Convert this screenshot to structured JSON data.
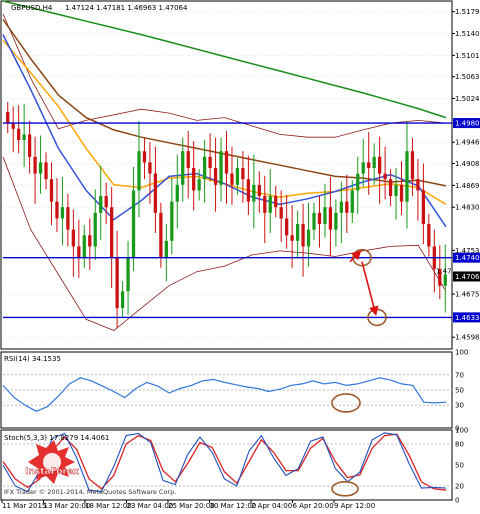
{
  "header": {
    "symbol": "GBPUSD,H4",
    "ohlc": "1.47124 1.47181 1.46963 1.47064"
  },
  "price_axis": {
    "ticks": [
      "1.51790",
      "1.51400",
      "1.51010",
      "1.50630",
      "1.50240",
      "1.49460",
      "1.49080",
      "1.48690",
      "1.48300",
      "1.47530",
      "1.46750",
      "1.45980"
    ],
    "levels": [
      "1.49802",
      "1.47400",
      "1.46334"
    ],
    "current": "1.47064",
    "current_left": "1.47"
  },
  "rsi_panel": {
    "label": "RSI(14) 34.1535",
    "ticks": [
      "100",
      "70",
      "50",
      "30",
      "0"
    ]
  },
  "stoch_panel": {
    "label": "Stoch(5,3,3) 17.8279 14.4061",
    "ticks": [
      "100",
      "80",
      "50",
      "20",
      "0"
    ]
  },
  "time_axis": [
    "11 Mar 2015",
    "13 Mar 20:00",
    "18 Mar 12:00",
    "23 Mar 04:00",
    "25 Mar 20:00",
    "30 Mar 12:00",
    "2 Apr 04:00",
    "6 Apr 20:00",
    "9 Apr 12:00"
  ],
  "watermark": {
    "brand": "InstaForex",
    "copyright": "IFX Trader © 2001-2014, MetaQuotes Software Corp."
  },
  "chart_data": {
    "type": "line",
    "title": "GBPUSD,H4",
    "ylim": [
      1.4577,
      1.5198
    ],
    "close": [
      1.498,
      1.497,
      1.495,
      1.496,
      1.492,
      1.489,
      1.491,
      1.488,
      1.484,
      1.481,
      1.483,
      1.479,
      1.476,
      1.474,
      1.478,
      1.476,
      1.482,
      1.485,
      1.483,
      1.474,
      1.465,
      1.468,
      1.474,
      1.486,
      1.493,
      1.491,
      1.489,
      1.482,
      1.474,
      1.477,
      1.484,
      1.487,
      1.493,
      1.49,
      1.486,
      1.488,
      1.492,
      1.49,
      1.487,
      1.493,
      1.489,
      1.487,
      1.49,
      1.488,
      1.484,
      1.487,
      1.485,
      1.482,
      1.485,
      1.483,
      1.481,
      1.478,
      1.477,
      1.48,
      1.476,
      1.479,
      1.482,
      1.48,
      1.483,
      1.479,
      1.482,
      1.484,
      1.482,
      1.486,
      1.489,
      1.491,
      1.49,
      1.492,
      1.489,
      1.488,
      1.485,
      1.487,
      1.484,
      1.493,
      1.488,
      1.486,
      1.48,
      1.476,
      1.472,
      1.469,
      1.471
    ],
    "series": [
      {
        "name": "MA green",
        "color": "#1a8c1a",
        "values": [
          1.5198,
          1.5186,
          1.5174,
          1.5162,
          1.515,
          1.5138,
          1.5125,
          1.5112,
          1.5099,
          1.5086,
          1.5073,
          1.506,
          1.5047,
          1.5034,
          1.502,
          1.5006,
          1.499
        ]
      },
      {
        "name": "MA brown",
        "color": "#8b4513",
        "values": [
          1.5165,
          1.5095,
          1.503,
          1.499,
          1.4968,
          1.4955,
          1.4945,
          1.4935,
          1.4925,
          1.4915,
          1.4905,
          1.4895,
          1.4885,
          1.4882,
          1.4875,
          1.4878,
          1.4868
        ]
      },
      {
        "name": "MA orange",
        "color": "#ffa500",
        "values": [
          1.5128,
          1.507,
          1.501,
          1.4935,
          1.487,
          1.4865,
          1.4882,
          1.4885,
          1.4872,
          1.4858,
          1.4848,
          1.4855,
          1.4858,
          1.4865,
          1.4872,
          1.4865,
          1.4835
        ]
      },
      {
        "name": "MA blue",
        "color": "#3355dd",
        "values": [
          1.5138,
          1.504,
          1.4935,
          1.486,
          1.4808,
          1.4842,
          1.4885,
          1.489,
          1.4872,
          1.4848,
          1.4835,
          1.4845,
          1.4858,
          1.4875,
          1.4888,
          1.4868,
          1.4795
        ]
      }
    ],
    "bands": {
      "upper": [
        1.5175,
        1.506,
        1.497,
        1.4985,
        1.4995,
        1.5005,
        1.4998,
        1.4985,
        1.499,
        1.4975,
        1.496,
        1.4955,
        1.4955,
        1.4968,
        1.498,
        1.4985,
        1.498
      ],
      "lower": [
        1.492,
        1.479,
        1.471,
        1.463,
        1.461,
        1.465,
        1.469,
        1.4715,
        1.4725,
        1.4745,
        1.4752,
        1.4748,
        1.4742,
        1.4752,
        1.476,
        1.4762,
        1.468
      ]
    },
    "rsi": [
      56,
      40,
      30,
      22,
      28,
      42,
      58,
      66,
      62,
      55,
      48,
      40,
      52,
      60,
      55,
      46,
      52,
      56,
      62,
      64,
      60,
      57,
      54,
      52,
      48,
      51,
      56,
      58,
      62,
      58,
      60,
      56,
      58,
      62,
      66,
      63,
      58,
      56,
      34,
      33,
      34
    ],
    "stoch_main": [
      50,
      20,
      12,
      42,
      88,
      95,
      60,
      14,
      12,
      48,
      92,
      95,
      82,
      28,
      22,
      65,
      90,
      68,
      30,
      20,
      70,
      92,
      60,
      35,
      45,
      84,
      90,
      45,
      26,
      40,
      86,
      96,
      93,
      52,
      17,
      18,
      17
    ],
    "stoch_signal": [
      55,
      30,
      18,
      30,
      70,
      90,
      72,
      30,
      16,
      35,
      80,
      92,
      85,
      42,
      26,
      52,
      82,
      75,
      40,
      24,
      55,
      86,
      68,
      42,
      42,
      74,
      88,
      55,
      32,
      36,
      74,
      92,
      94,
      64,
      26,
      16,
      14
    ]
  }
}
